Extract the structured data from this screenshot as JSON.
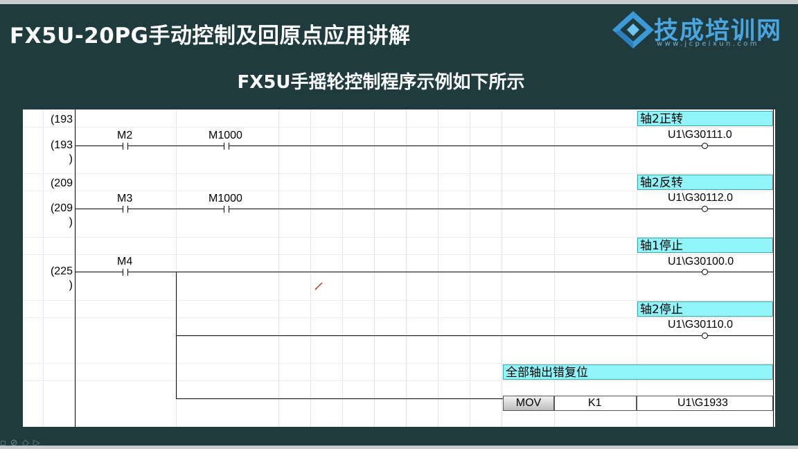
{
  "header": {
    "title": "FX5U-20PG手动控制及回原点应用讲解",
    "subtitle": "FX5U手摇轮控制程序示例如下所示"
  },
  "logo": {
    "name": "技成培训网",
    "url": "www.jcpeixun.com"
  },
  "ladder": {
    "rows": [
      {
        "step": "(193",
        "sub": ""
      },
      {
        "step": "(193",
        "sub": ")"
      },
      {
        "step": "(209",
        "sub": ""
      },
      {
        "step": "(209",
        "sub": ")"
      },
      {
        "step": "(225",
        "sub": ")"
      }
    ],
    "rung1": {
      "contact1": "M2",
      "contact2": "M1000",
      "comment": "轴2正转",
      "coil": "U1\\G30111.0"
    },
    "rung2": {
      "contact1": "M3",
      "contact2": "M1000",
      "comment": "轴2反转",
      "coil": "U1\\G30112.0"
    },
    "rung3": {
      "contact1": "M4",
      "out1_comment": "轴1停止",
      "out1_coil": "U1\\G30100.0",
      "out2_comment": "轴2停止",
      "out2_coil": "U1\\G30110.0",
      "out3_comment": "全部轴出错复位",
      "instr": "MOV",
      "operand1": "K1",
      "operand2": "U1\\G1933"
    }
  },
  "colors": {
    "background": "#1f3b3e",
    "comment_fill": "#91f4f9",
    "logo_blue": "#4aa6e0"
  }
}
